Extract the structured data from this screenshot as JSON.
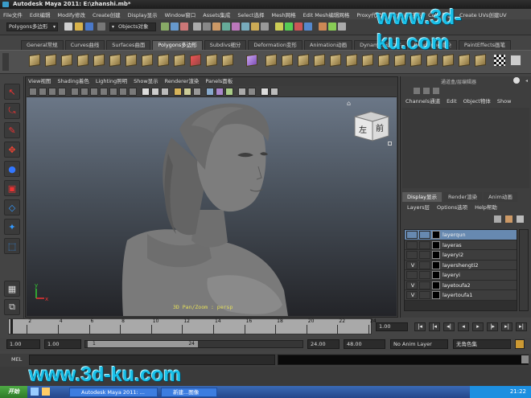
{
  "window": {
    "title": "Autodesk Maya 2011: E:\\zhanshi.mb*"
  },
  "menubar": [
    "File文件",
    "Edit编辑",
    "Modify修改",
    "Create创建",
    "Display显示",
    "Window窗口",
    "Assets集成",
    "Select选择",
    "Mesh网格",
    "Edit Mesh编辑网格",
    "Proxy代理",
    "Normals法线",
    "Color颜色",
    "Create UVs创建UV"
  ],
  "status_line": {
    "mode": "Polygons多边形",
    "object_field": "Objects对象"
  },
  "shelf_tabs": [
    {
      "label": "General常规",
      "active": false
    },
    {
      "label": "Curves曲线",
      "active": false
    },
    {
      "label": "Surfaces曲面",
      "active": false
    },
    {
      "label": "Polygons多边形",
      "active": true
    },
    {
      "label": "Subdivs细分",
      "active": false
    },
    {
      "label": "Deformation变形",
      "active": false
    },
    {
      "label": "Animation动画",
      "active": false
    },
    {
      "label": "Dynamics动力学",
      "active": false
    },
    {
      "label": "Rendering渲染",
      "active": false
    },
    {
      "label": "PaintEffects画笔",
      "active": false
    }
  ],
  "viewport": {
    "menu": [
      "View视图",
      "Shading着色",
      "Lighting照明",
      "Show显示",
      "Renderer渲染",
      "Panels面板"
    ],
    "viewcube": {
      "left": "左",
      "front": "前"
    },
    "hud": "3D Pan/Zoom : persp",
    "axis_x": "x",
    "axis_y": "y"
  },
  "channel_box": {
    "title": "通道盒/层编辑器",
    "menu": [
      "Channels通道",
      "Edit",
      "Object物体",
      "Show"
    ]
  },
  "layer_editor": {
    "tabs": [
      {
        "label": "Display显示",
        "active": true
      },
      {
        "label": "Render渲染",
        "active": false
      },
      {
        "label": "Anim动画",
        "active": false
      }
    ],
    "menu": [
      "Layers层",
      "Options选项",
      "Help帮助"
    ],
    "layers": [
      {
        "name": "layerqun",
        "visible": "",
        "selected": true
      },
      {
        "name": "layeras",
        "visible": "",
        "selected": false
      },
      {
        "name": "layeryi2",
        "visible": "",
        "selected": false
      },
      {
        "name": "layershengti2",
        "visible": "V",
        "selected": false
      },
      {
        "name": "layeryi",
        "visible": "",
        "selected": false
      },
      {
        "name": "layetoufa2",
        "visible": "V",
        "selected": false
      },
      {
        "name": "layertoufa1",
        "visible": "V",
        "selected": false
      }
    ]
  },
  "time_slider": {
    "ticks": [
      "2",
      "4",
      "6",
      "8",
      "10",
      "12",
      "14",
      "16",
      "18",
      "20",
      "22",
      "24"
    ],
    "current_frame": "1.00"
  },
  "range_slider": {
    "start_time": "1.00",
    "playback_start": "1.00",
    "range_start_label": "1",
    "range_end_label": "24",
    "playback_end": "24.00",
    "end_time": "48.00",
    "anim_layer": "No Anim Layer",
    "character_set": "无角色集"
  },
  "command_line": {
    "label": "MEL"
  },
  "taskbar": {
    "start": "开始",
    "items": [
      "",
      "Autodesk Maya 2011: ...",
      "新建...图像"
    ],
    "clock": "21:22"
  },
  "watermark": "www.3d-ku.com",
  "colors": {
    "accent_selected": "#6789b0",
    "watermark": "#19c0e8"
  }
}
